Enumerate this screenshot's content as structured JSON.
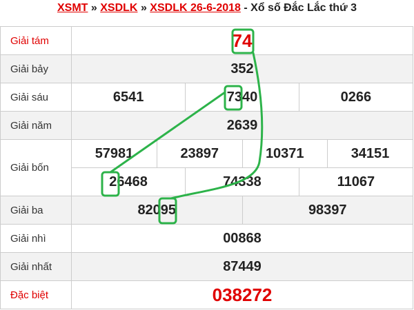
{
  "breadcrumb": {
    "link1": "XSMT",
    "sep1": "»",
    "link2": "XSDLK",
    "sep2": "»",
    "link3": "XSDLK 26-6-2018",
    "sep3": "-",
    "title": "Xổ số Đắc Lắc thứ 3"
  },
  "prizes": {
    "g8": {
      "label": "Giải tám",
      "numbers": [
        "74"
      ]
    },
    "g7": {
      "label": "Giải bảy",
      "numbers": [
        "352"
      ]
    },
    "g6": {
      "label": "Giải sáu",
      "numbers": [
        "6541",
        "7340",
        "0266"
      ]
    },
    "g5": {
      "label": "Giải năm",
      "numbers": [
        "2639"
      ]
    },
    "g4": {
      "label": "Giải bốn",
      "numbers": [
        "57981",
        "23897",
        "10371",
        "34151",
        "26468",
        "74338",
        "11067"
      ]
    },
    "g3": {
      "label": "Giải ba",
      "numbers": [
        "82095",
        "98397"
      ]
    },
    "g2": {
      "label": "Giải nhì",
      "numbers": [
        "00868"
      ]
    },
    "g1": {
      "label": "Giải nhất",
      "numbers": [
        "87449"
      ]
    },
    "db": {
      "label": "Đặc biệt",
      "numbers": [
        "038272"
      ]
    }
  },
  "colors": {
    "accent_red": "#e00000",
    "highlight_green": "#2db34a",
    "border": "#cccccc",
    "row_alt": "#f2f2f2"
  }
}
